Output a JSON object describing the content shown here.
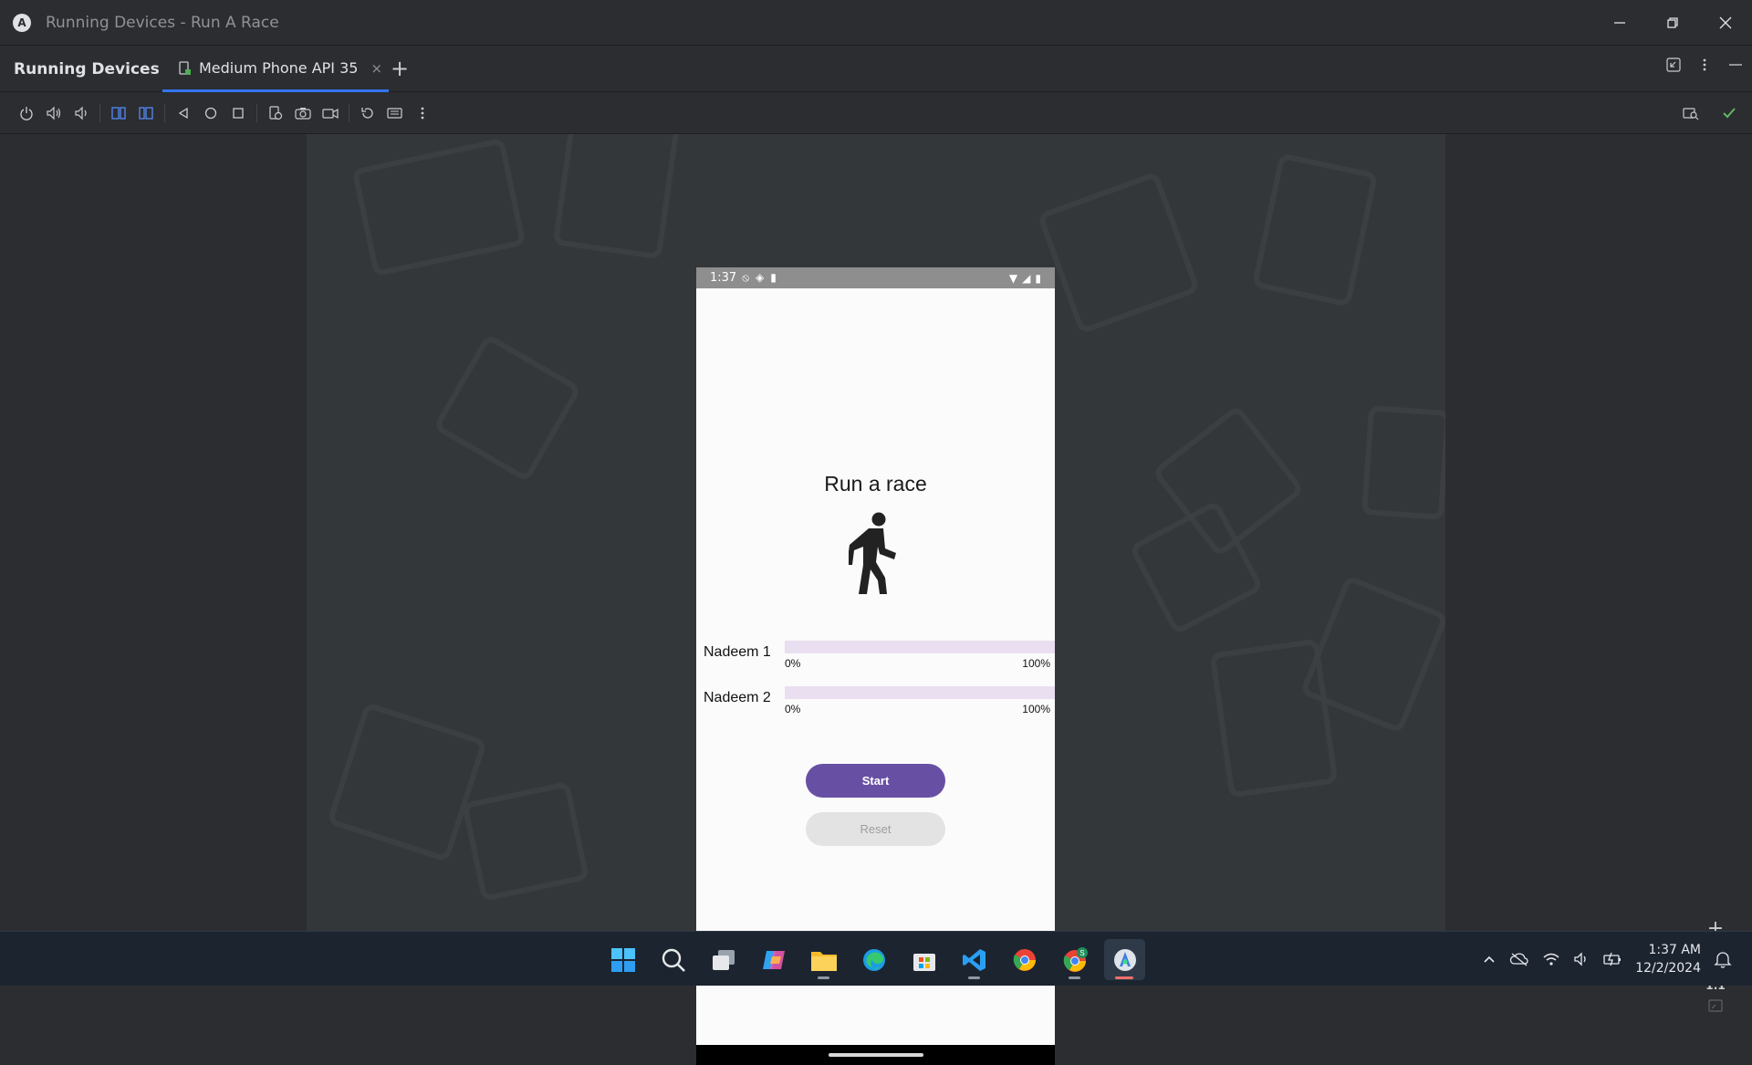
{
  "window": {
    "title": "Running Devices - Run A Race",
    "logo_letter": "A"
  },
  "tabbar": {
    "panel_title": "Running Devices",
    "tab_label": "Medium Phone API 35",
    "tab_close": "×",
    "add_tab": "+"
  },
  "toolbar": {
    "icons": [
      "power-icon",
      "volume-up-icon",
      "volume-down-icon",
      "rotate-left-icon",
      "rotate-right-icon",
      "back-icon",
      "home-icon",
      "overview-icon",
      "device-manager-icon",
      "screenshot-icon",
      "screen-record-icon",
      "reset-icon",
      "keyboard-icon",
      "more-options-icon"
    ]
  },
  "phone": {
    "status_time": "1:37",
    "app_title": "Run a race",
    "racers": [
      {
        "name": "Nadeem 1",
        "progress": 0,
        "min_label": "0%",
        "max_label": "100%"
      },
      {
        "name": "Nadeem 2",
        "progress": 0,
        "min_label": "0%",
        "max_label": "100%"
      }
    ],
    "start_label": "Start",
    "reset_label": "Reset"
  },
  "zoom": {
    "zoom_in": "+",
    "zoom_out": "—",
    "actual_size": "1:1"
  },
  "taskbar": {
    "time": "1:37 AM",
    "date": "12/2/2024",
    "chrome_badge": "S"
  },
  "colors": {
    "accent": "#3574f0",
    "button_primary": "#6750a4",
    "track": "#e9dff0"
  }
}
